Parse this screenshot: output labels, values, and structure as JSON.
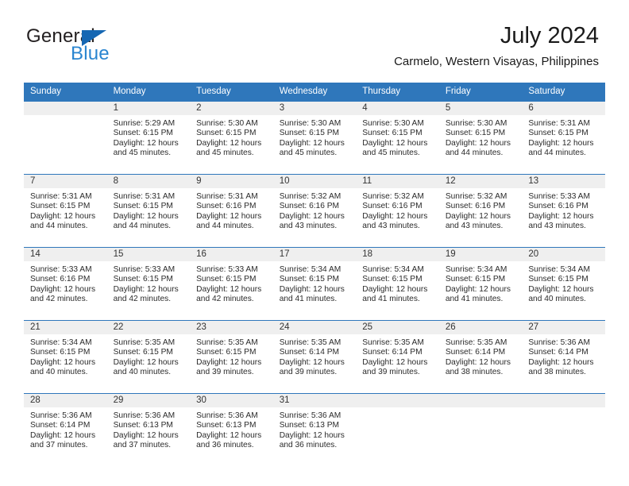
{
  "brand": {
    "name_part1": "General",
    "name_part2": "Blue"
  },
  "header": {
    "title": "July 2024",
    "location": "Carmelo, Western Visayas, Philippines"
  },
  "colors": {
    "header_blue": "#2f77bb",
    "brand_blue": "#2a85d0",
    "daynum_band": "#efefef"
  },
  "weekdays": [
    "Sunday",
    "Monday",
    "Tuesday",
    "Wednesday",
    "Thursday",
    "Friday",
    "Saturday"
  ],
  "weeks": [
    [
      {
        "day": "",
        "sunrise": "",
        "sunset": "",
        "daylight_line1": "",
        "daylight_line2": ""
      },
      {
        "day": "1",
        "sunrise": "Sunrise: 5:29 AM",
        "sunset": "Sunset: 6:15 PM",
        "daylight_line1": "Daylight: 12 hours",
        "daylight_line2": "and 45 minutes."
      },
      {
        "day": "2",
        "sunrise": "Sunrise: 5:30 AM",
        "sunset": "Sunset: 6:15 PM",
        "daylight_line1": "Daylight: 12 hours",
        "daylight_line2": "and 45 minutes."
      },
      {
        "day": "3",
        "sunrise": "Sunrise: 5:30 AM",
        "sunset": "Sunset: 6:15 PM",
        "daylight_line1": "Daylight: 12 hours",
        "daylight_line2": "and 45 minutes."
      },
      {
        "day": "4",
        "sunrise": "Sunrise: 5:30 AM",
        "sunset": "Sunset: 6:15 PM",
        "daylight_line1": "Daylight: 12 hours",
        "daylight_line2": "and 45 minutes."
      },
      {
        "day": "5",
        "sunrise": "Sunrise: 5:30 AM",
        "sunset": "Sunset: 6:15 PM",
        "daylight_line1": "Daylight: 12 hours",
        "daylight_line2": "and 44 minutes."
      },
      {
        "day": "6",
        "sunrise": "Sunrise: 5:31 AM",
        "sunset": "Sunset: 6:15 PM",
        "daylight_line1": "Daylight: 12 hours",
        "daylight_line2": "and 44 minutes."
      }
    ],
    [
      {
        "day": "7",
        "sunrise": "Sunrise: 5:31 AM",
        "sunset": "Sunset: 6:15 PM",
        "daylight_line1": "Daylight: 12 hours",
        "daylight_line2": "and 44 minutes."
      },
      {
        "day": "8",
        "sunrise": "Sunrise: 5:31 AM",
        "sunset": "Sunset: 6:15 PM",
        "daylight_line1": "Daylight: 12 hours",
        "daylight_line2": "and 44 minutes."
      },
      {
        "day": "9",
        "sunrise": "Sunrise: 5:31 AM",
        "sunset": "Sunset: 6:16 PM",
        "daylight_line1": "Daylight: 12 hours",
        "daylight_line2": "and 44 minutes."
      },
      {
        "day": "10",
        "sunrise": "Sunrise: 5:32 AM",
        "sunset": "Sunset: 6:16 PM",
        "daylight_line1": "Daylight: 12 hours",
        "daylight_line2": "and 43 minutes."
      },
      {
        "day": "11",
        "sunrise": "Sunrise: 5:32 AM",
        "sunset": "Sunset: 6:16 PM",
        "daylight_line1": "Daylight: 12 hours",
        "daylight_line2": "and 43 minutes."
      },
      {
        "day": "12",
        "sunrise": "Sunrise: 5:32 AM",
        "sunset": "Sunset: 6:16 PM",
        "daylight_line1": "Daylight: 12 hours",
        "daylight_line2": "and 43 minutes."
      },
      {
        "day": "13",
        "sunrise": "Sunrise: 5:33 AM",
        "sunset": "Sunset: 6:16 PM",
        "daylight_line1": "Daylight: 12 hours",
        "daylight_line2": "and 43 minutes."
      }
    ],
    [
      {
        "day": "14",
        "sunrise": "Sunrise: 5:33 AM",
        "sunset": "Sunset: 6:16 PM",
        "daylight_line1": "Daylight: 12 hours",
        "daylight_line2": "and 42 minutes."
      },
      {
        "day": "15",
        "sunrise": "Sunrise: 5:33 AM",
        "sunset": "Sunset: 6:15 PM",
        "daylight_line1": "Daylight: 12 hours",
        "daylight_line2": "and 42 minutes."
      },
      {
        "day": "16",
        "sunrise": "Sunrise: 5:33 AM",
        "sunset": "Sunset: 6:15 PM",
        "daylight_line1": "Daylight: 12 hours",
        "daylight_line2": "and 42 minutes."
      },
      {
        "day": "17",
        "sunrise": "Sunrise: 5:34 AM",
        "sunset": "Sunset: 6:15 PM",
        "daylight_line1": "Daylight: 12 hours",
        "daylight_line2": "and 41 minutes."
      },
      {
        "day": "18",
        "sunrise": "Sunrise: 5:34 AM",
        "sunset": "Sunset: 6:15 PM",
        "daylight_line1": "Daylight: 12 hours",
        "daylight_line2": "and 41 minutes."
      },
      {
        "day": "19",
        "sunrise": "Sunrise: 5:34 AM",
        "sunset": "Sunset: 6:15 PM",
        "daylight_line1": "Daylight: 12 hours",
        "daylight_line2": "and 41 minutes."
      },
      {
        "day": "20",
        "sunrise": "Sunrise: 5:34 AM",
        "sunset": "Sunset: 6:15 PM",
        "daylight_line1": "Daylight: 12 hours",
        "daylight_line2": "and 40 minutes."
      }
    ],
    [
      {
        "day": "21",
        "sunrise": "Sunrise: 5:34 AM",
        "sunset": "Sunset: 6:15 PM",
        "daylight_line1": "Daylight: 12 hours",
        "daylight_line2": "and 40 minutes."
      },
      {
        "day": "22",
        "sunrise": "Sunrise: 5:35 AM",
        "sunset": "Sunset: 6:15 PM",
        "daylight_line1": "Daylight: 12 hours",
        "daylight_line2": "and 40 minutes."
      },
      {
        "day": "23",
        "sunrise": "Sunrise: 5:35 AM",
        "sunset": "Sunset: 6:15 PM",
        "daylight_line1": "Daylight: 12 hours",
        "daylight_line2": "and 39 minutes."
      },
      {
        "day": "24",
        "sunrise": "Sunrise: 5:35 AM",
        "sunset": "Sunset: 6:14 PM",
        "daylight_line1": "Daylight: 12 hours",
        "daylight_line2": "and 39 minutes."
      },
      {
        "day": "25",
        "sunrise": "Sunrise: 5:35 AM",
        "sunset": "Sunset: 6:14 PM",
        "daylight_line1": "Daylight: 12 hours",
        "daylight_line2": "and 39 minutes."
      },
      {
        "day": "26",
        "sunrise": "Sunrise: 5:35 AM",
        "sunset": "Sunset: 6:14 PM",
        "daylight_line1": "Daylight: 12 hours",
        "daylight_line2": "and 38 minutes."
      },
      {
        "day": "27",
        "sunrise": "Sunrise: 5:36 AM",
        "sunset": "Sunset: 6:14 PM",
        "daylight_line1": "Daylight: 12 hours",
        "daylight_line2": "and 38 minutes."
      }
    ],
    [
      {
        "day": "28",
        "sunrise": "Sunrise: 5:36 AM",
        "sunset": "Sunset: 6:14 PM",
        "daylight_line1": "Daylight: 12 hours",
        "daylight_line2": "and 37 minutes."
      },
      {
        "day": "29",
        "sunrise": "Sunrise: 5:36 AM",
        "sunset": "Sunset: 6:13 PM",
        "daylight_line1": "Daylight: 12 hours",
        "daylight_line2": "and 37 minutes."
      },
      {
        "day": "30",
        "sunrise": "Sunrise: 5:36 AM",
        "sunset": "Sunset: 6:13 PM",
        "daylight_line1": "Daylight: 12 hours",
        "daylight_line2": "and 36 minutes."
      },
      {
        "day": "31",
        "sunrise": "Sunrise: 5:36 AM",
        "sunset": "Sunset: 6:13 PM",
        "daylight_line1": "Daylight: 12 hours",
        "daylight_line2": "and 36 minutes."
      },
      {
        "day": "",
        "sunrise": "",
        "sunset": "",
        "daylight_line1": "",
        "daylight_line2": ""
      },
      {
        "day": "",
        "sunrise": "",
        "sunset": "",
        "daylight_line1": "",
        "daylight_line2": ""
      },
      {
        "day": "",
        "sunrise": "",
        "sunset": "",
        "daylight_line1": "",
        "daylight_line2": ""
      }
    ]
  ]
}
